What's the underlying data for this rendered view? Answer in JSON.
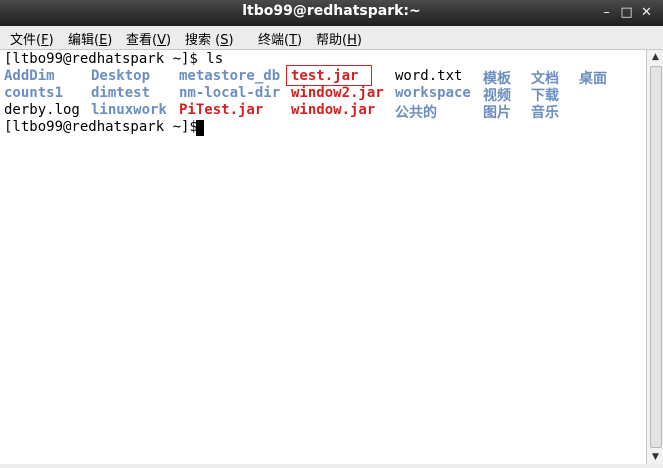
{
  "window": {
    "title": "ltbo99@redhatspark:~",
    "controls": {
      "minimize": "–",
      "maximize": "□",
      "close": "✕"
    }
  },
  "menu": [
    {
      "label": "文件(",
      "acc": "F",
      "end": ")"
    },
    {
      "label": "编辑(",
      "acc": "E",
      "end": ")"
    },
    {
      "label": "查看(",
      "acc": "V",
      "end": ")"
    },
    {
      "label": "搜索 (",
      "acc": "S",
      "end": ")"
    },
    {
      "label": "终端(",
      "acc": "T",
      "end": ")"
    },
    {
      "label": "帮助(",
      "acc": "H",
      "end": ")"
    }
  ],
  "terminal": {
    "prompt_command": "[ltbo99@redhatspark ~]$ ls",
    "prompt_final": "[ltbo99@redhatspark ~]$ ",
    "ls": {
      "row1": [
        "AddDim",
        "Desktop",
        "metastore_db",
        "test.jar",
        "word.txt",
        "模板",
        "文档",
        "桌面"
      ],
      "row2": [
        "counts1",
        "dimtest",
        "nm-local-dir",
        "window2.jar",
        "workspace",
        "视频",
        "下载"
      ],
      "row3": [
        "derby.log",
        "linuxwork",
        "PiTest.jar",
        "window.jar",
        "公共的",
        "图片",
        "音乐"
      ]
    }
  },
  "colors": {
    "directory": "#6b8fbf",
    "jar": "#d42020",
    "highlight": "#e02020"
  }
}
